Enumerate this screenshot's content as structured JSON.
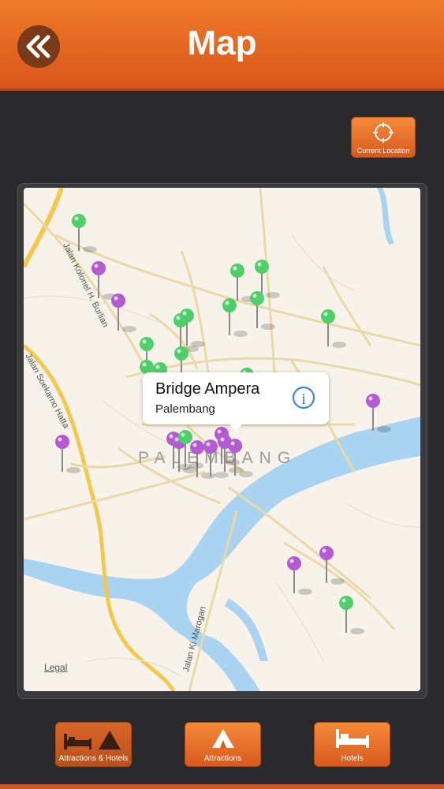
{
  "header": {
    "title": "Map",
    "back_icon": "double-chevron-left-icon"
  },
  "current_location": {
    "label": "Current Location",
    "icon": "crosshair-icon"
  },
  "map": {
    "city_label": "PALEMBANG",
    "legal": "Legal",
    "roads": [
      "Jalan Kolonel H. Burlian",
      "Jalan Soekarno Hatta",
      "Jalan Ki Marogan"
    ],
    "callout": {
      "title": "Bridge Ampera",
      "subtitle": "Palembang",
      "icon": "info-icon"
    },
    "pin_colors": {
      "attraction": "#4fcf6a",
      "hotel": "#b45ad3"
    }
  },
  "footer": {
    "tabs": [
      {
        "label": "Attractions & Hotels",
        "icon": "bed-and-tent-icon",
        "active": true
      },
      {
        "label": "Attractions",
        "icon": "tent-icon",
        "active": false
      },
      {
        "label": "Hotels",
        "icon": "bed-icon",
        "active": false
      }
    ]
  }
}
